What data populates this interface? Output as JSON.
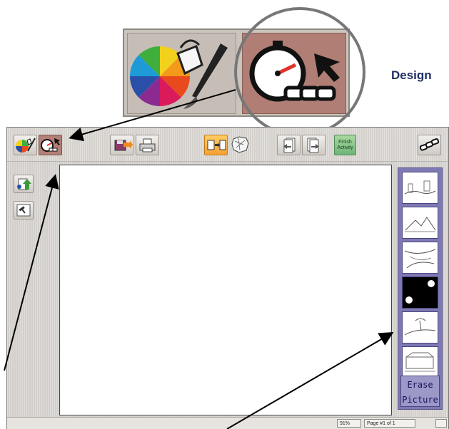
{
  "callout": {
    "label": "Design"
  },
  "toolbar": {
    "buttons": [
      {
        "name": "paint-tools",
        "icon": "color-wheel-icon"
      },
      {
        "name": "design-mode",
        "icon": "stopwatch-icon"
      },
      {
        "name": "save",
        "icon": "save-icon"
      },
      {
        "name": "print",
        "icon": "printer-icon"
      },
      {
        "name": "copy-page",
        "icon": "copy-page-icon"
      },
      {
        "name": "clear",
        "icon": "crumpled-paper-icon"
      },
      {
        "name": "previous-page",
        "icon": "previous-page-icon"
      },
      {
        "name": "next-page",
        "icon": "next-page-icon"
      },
      {
        "name": "finish-activity",
        "label": "Finish\nActivity"
      },
      {
        "name": "chain",
        "icon": "chain-icon"
      }
    ],
    "finish_label": "Finish Activity"
  },
  "left_tools": [
    {
      "name": "stamp-tool",
      "icon": "stamp-icon"
    },
    {
      "name": "select-tool",
      "icon": "hammer-icon"
    }
  ],
  "gallery": {
    "thumbnails": [
      "city-scene",
      "mountain-scene",
      "river-scene",
      "night-sky-scene",
      "beach-scene",
      "street-scene"
    ],
    "erase_line1": "Erase",
    "erase_line2": "Picture"
  },
  "status": {
    "zoom": "91%",
    "page": "Page #1 of 1"
  },
  "colors": {
    "pressed_button": "#b37f76",
    "gallery_bg": "#7e79b2",
    "design_label": "#1f2f63",
    "finish_button": "#6fb577"
  }
}
